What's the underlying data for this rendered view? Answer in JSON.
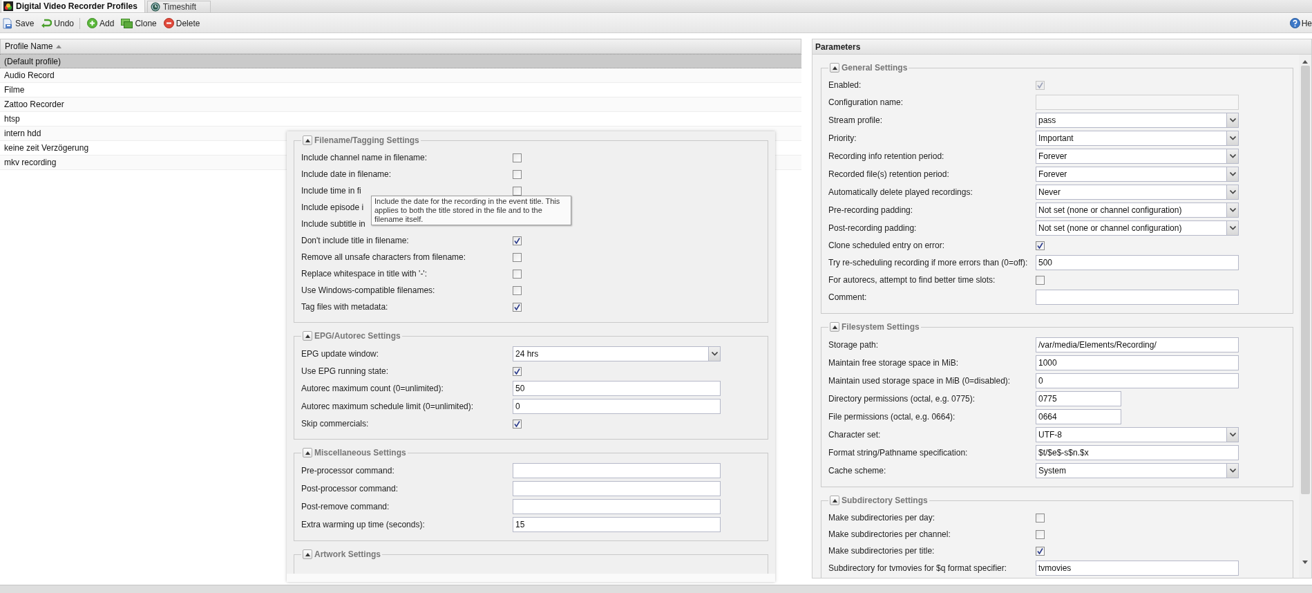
{
  "tabs": [
    {
      "label": "Digital Video Recorder Profiles",
      "selected": true
    },
    {
      "label": "Timeshift",
      "selected": false
    }
  ],
  "toolbar": {
    "buttons": [
      {
        "label": "Save"
      },
      {
        "label": "Undo"
      },
      {
        "label": "Add"
      },
      {
        "label": "Clone"
      },
      {
        "label": "Delete"
      }
    ],
    "help": {
      "label": "He"
    }
  },
  "grid": {
    "column": "Profile Name",
    "rows": [
      {
        "name": "(Default profile)",
        "selected": true
      },
      {
        "name": "Audio Record",
        "selected": false
      },
      {
        "name": "Filme",
        "selected": false
      },
      {
        "name": "Zattoo Recorder",
        "selected": false
      },
      {
        "name": "htsp",
        "selected": false
      },
      {
        "name": "intern hdd",
        "selected": false
      },
      {
        "name": "keine zeit Verzögerung",
        "selected": false
      },
      {
        "name": "mkv recording",
        "selected": false
      }
    ]
  },
  "floating_panel": {
    "tooltip": "Include the date for the recording in the event title. This applies to both the title stored in the file and to the filename itself.",
    "sections": [
      {
        "title": "Filename/Tagging Settings",
        "expanded": true,
        "fields": [
          {
            "kind": "checkbox",
            "label": "Include channel name in filename:",
            "checked": false
          },
          {
            "kind": "checkbox",
            "label": "Include date in filename:",
            "checked": false
          },
          {
            "kind": "checkbox",
            "label": "Include time in fi",
            "checked": false
          },
          {
            "kind": "label",
            "label": "Include episode i"
          },
          {
            "kind": "label",
            "label": "Include subtitle in"
          },
          {
            "kind": "checkbox",
            "label": "Don't include title in filename:",
            "checked": true
          },
          {
            "kind": "checkbox",
            "label": "Remove all unsafe characters from filename:",
            "checked": false
          },
          {
            "kind": "checkbox",
            "label": "Replace whitespace in title with '-':",
            "checked": false
          },
          {
            "kind": "checkbox",
            "label": "Use Windows-compatible filenames:",
            "checked": false
          },
          {
            "kind": "checkbox",
            "label": "Tag files with metadata:",
            "checked": true
          }
        ]
      },
      {
        "title": "EPG/Autorec Settings",
        "expanded": true,
        "fields": [
          {
            "kind": "select",
            "label": "EPG update window:",
            "value": "24 hrs"
          },
          {
            "kind": "checkbox",
            "label": "Use EPG running state:",
            "checked": true
          },
          {
            "kind": "text",
            "label": "Autorec maximum count (0=unlimited):",
            "value": "50"
          },
          {
            "kind": "text",
            "label": "Autorec maximum schedule limit (0=unlimited):",
            "value": "0"
          },
          {
            "kind": "checkbox",
            "label": "Skip commercials:",
            "checked": true
          }
        ]
      },
      {
        "title": "Miscellaneous Settings",
        "expanded": true,
        "fields": [
          {
            "kind": "text",
            "label": "Pre-processor command:"
          },
          {
            "kind": "text",
            "label": "Post-processor command:"
          },
          {
            "kind": "text",
            "label": "Post-remove command:"
          },
          {
            "kind": "text",
            "label": "Extra warming up time (seconds):",
            "value": "15"
          }
        ]
      },
      {
        "title": "Artwork Settings",
        "expanded": true
      }
    ]
  },
  "parameters": {
    "title": "Parameters",
    "sections": [
      {
        "title": "General Settings",
        "expanded": true,
        "fields": [
          {
            "kind": "checkbox",
            "label": "Enabled:",
            "checked": true,
            "disabled": true
          },
          {
            "kind": "text",
            "label": "Configuration name:",
            "disabled": true
          },
          {
            "kind": "select",
            "label": "Stream profile:",
            "value": "pass"
          },
          {
            "kind": "select",
            "label": "Priority:",
            "value": "Important"
          },
          {
            "kind": "select",
            "label": "Recording info retention period:",
            "value": "Forever"
          },
          {
            "kind": "select",
            "label": "Recorded file(s) retention period:",
            "value": "Forever"
          },
          {
            "kind": "select",
            "label": "Automatically delete played recordings:",
            "value": "Never"
          },
          {
            "kind": "select",
            "label": "Pre-recording padding:",
            "value": "Not set (none or channel configuration)"
          },
          {
            "kind": "select",
            "label": "Post-recording padding:",
            "value": "Not set (none or channel configuration)"
          },
          {
            "kind": "checkbox",
            "label": "Clone scheduled entry on error:",
            "checked": true
          },
          {
            "kind": "text",
            "label": "Try re-scheduling recording if more errors than (0=off):",
            "value": "500"
          },
          {
            "kind": "checkbox",
            "label": "For autorecs, attempt to find better time slots:",
            "checked": false
          },
          {
            "kind": "text",
            "label": "Comment:"
          }
        ]
      },
      {
        "title": "Filesystem Settings",
        "expanded": true,
        "fields": [
          {
            "kind": "text",
            "label": "Storage path:",
            "value": "/var/media/Elements/Recording/"
          },
          {
            "kind": "text",
            "label": "Maintain free storage space in MiB:",
            "value": "1000"
          },
          {
            "kind": "text",
            "label": "Maintain used storage space in MiB (0=disabled):",
            "value": "0"
          },
          {
            "kind": "short_text",
            "label": "Directory permissions (octal, e.g. 0775):",
            "value": "0775"
          },
          {
            "kind": "short_text",
            "label": "File permissions (octal, e.g. 0664):",
            "value": "0664"
          },
          {
            "kind": "select",
            "label": "Character set:",
            "value": "UTF-8"
          },
          {
            "kind": "text",
            "label": "Format string/Pathname specification:",
            "value": "$t/$e$-s$n.$x"
          },
          {
            "kind": "select",
            "label": "Cache scheme:",
            "value": "System"
          }
        ]
      },
      {
        "title": "Subdirectory Settings",
        "expanded": true,
        "fields": [
          {
            "kind": "checkbox",
            "label": "Make subdirectories per day:",
            "checked": false
          },
          {
            "kind": "checkbox",
            "label": "Make subdirectories per channel:",
            "checked": false
          },
          {
            "kind": "checkbox",
            "label": "Make subdirectories per title:",
            "checked": true
          },
          {
            "kind": "text",
            "label": "Subdirectory for tvmovies for $q format specifier:",
            "value": "tvmovies"
          }
        ]
      }
    ]
  }
}
